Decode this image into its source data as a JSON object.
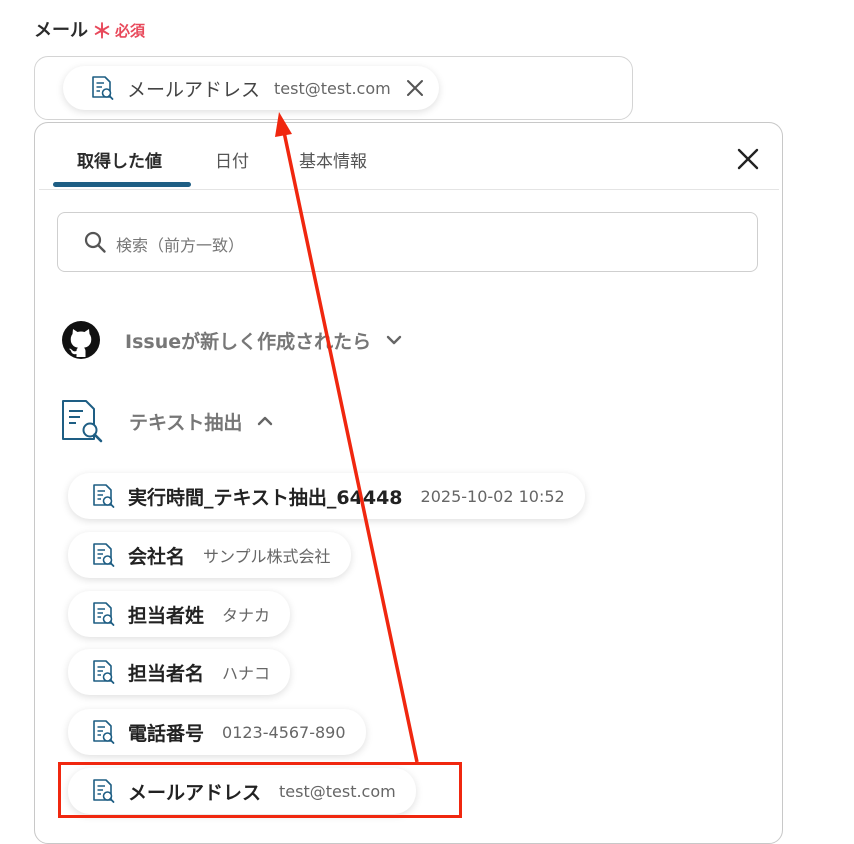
{
  "field": {
    "label": "メール",
    "required_label": "必須",
    "required_mark": "＊",
    "selected": {
      "name": "メールアドレス",
      "value": "test@test.com"
    }
  },
  "panel": {
    "tabs": [
      {
        "label": "取得した値",
        "active": true
      },
      {
        "label": "日付",
        "active": false
      },
      {
        "label": "基本情報",
        "active": false
      }
    ],
    "search_placeholder": "検索（前方一致）",
    "groups": [
      {
        "label": "Issueが新しく作成されたら",
        "icon": "github-icon",
        "expanded": false
      },
      {
        "label": "テキスト抽出",
        "icon": "document-search-icon",
        "expanded": true
      }
    ],
    "items": [
      {
        "name": "実行時間_テキスト抽出_64448",
        "value": "2025-10-02 10:52"
      },
      {
        "name": "会社名",
        "value": "サンプル株式会社"
      },
      {
        "name": "担当者姓",
        "value": "タナカ"
      },
      {
        "name": "担当者名",
        "value": "ハナコ"
      },
      {
        "name": "電話番号",
        "value": "0123-4567-890"
      },
      {
        "name": "メールアドレス",
        "value": "test@test.com"
      }
    ]
  },
  "colors": {
    "accent": "#1e5e84",
    "required": "#e8495b",
    "annotation": "#f0270f"
  }
}
